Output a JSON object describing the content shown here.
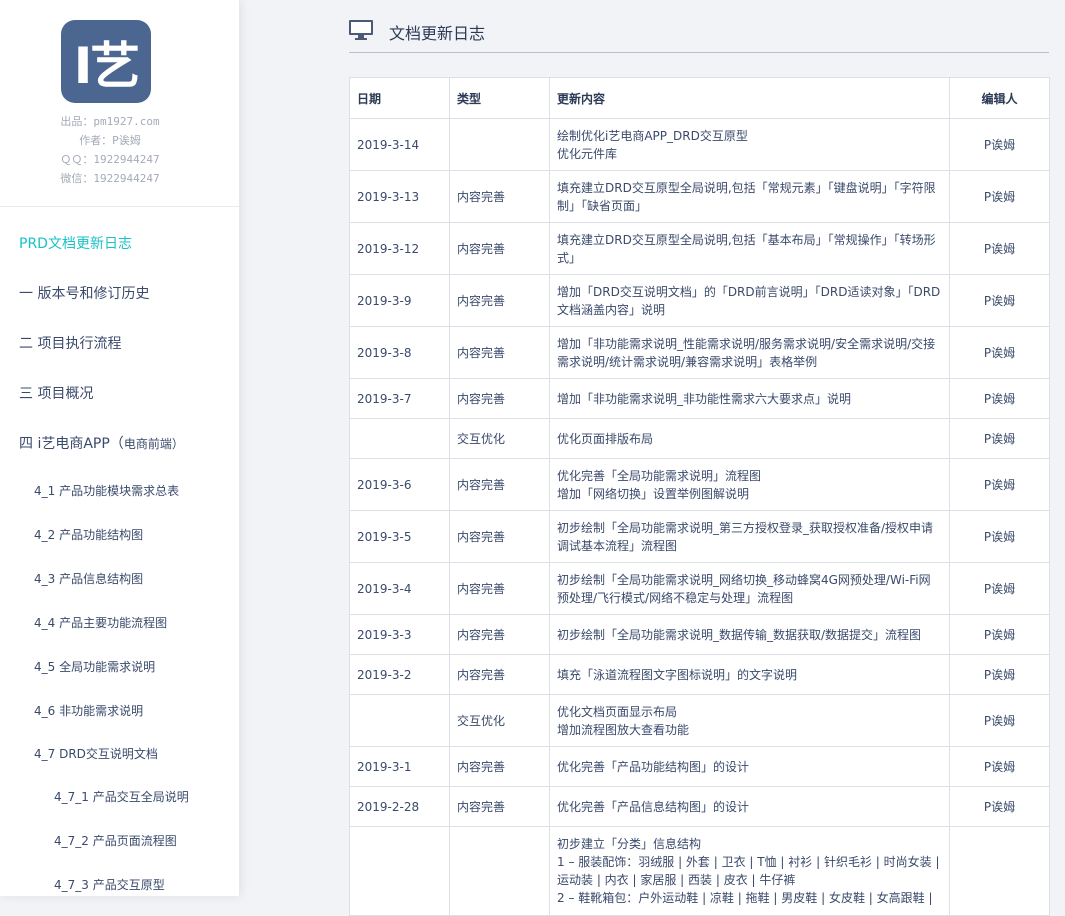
{
  "sidebar": {
    "logo_text": "I艺",
    "meta": [
      "出品：pm1927.com",
      "作者：P诶姆",
      "ＱＱ：1922944247",
      "微信：1922944247"
    ],
    "nav": [
      {
        "label": "PRD文档更新日志",
        "active": true
      },
      {
        "label": "一 版本号和修订历史"
      },
      {
        "label": "二 项目执行流程"
      },
      {
        "label": "三 项目概况"
      },
      {
        "label": "四 i艺电商APP（",
        "suffix": "电商前端）"
      },
      {
        "label": "4_1 产品功能模块需求总表"
      },
      {
        "label": "4_2 产品功能结构图"
      },
      {
        "label": "4_3 产品信息结构图"
      },
      {
        "label": "4_4 产品主要功能流程图"
      },
      {
        "label": "4_5 全局功能需求说明"
      },
      {
        "label": "4_6 非功能需求说明"
      },
      {
        "label": "4_7 DRD交互说明文档"
      },
      {
        "label": "4_7_1 产品交互全局说明"
      },
      {
        "label": "4_7_2 产品页面流程图"
      },
      {
        "label": "4_7_3 产品交互原型"
      }
    ]
  },
  "header": {
    "title": "文档更新日志",
    "icon": "monitor-icon"
  },
  "table": {
    "columns": [
      "日期",
      "类型",
      "更新内容",
      "编辑人"
    ],
    "rows": [
      {
        "date": "2019-3-14",
        "type": "",
        "content": [
          "绘制优化i艺电商APP_DRD交互原型",
          "优化元件库"
        ],
        "editor": "P诶姆"
      },
      {
        "date": "2019-3-13",
        "type": "内容完善",
        "content": [
          "填充建立DRD交互原型全局说明,包括「常规元素」「键盘说明」「字符限制」「缺省页面」"
        ],
        "editor": "P诶姆"
      },
      {
        "date": "2019-3-12",
        "type": "内容完善",
        "content": [
          "填充建立DRD交互原型全局说明,包括「基本布局」「常规操作」「转场形式」"
        ],
        "editor": "P诶姆"
      },
      {
        "date": "2019-3-9",
        "type": "内容完善",
        "content": [
          "增加「DRD交互说明文档」的「DRD前言说明」「DRD适读对象」「DRD文档涵盖内容」说明"
        ],
        "editor": "P诶姆"
      },
      {
        "date": "2019-3-8",
        "type": "内容完善",
        "content": [
          "增加「非功能需求说明_性能需求说明/服务需求说明/安全需求说明/交接需求说明/统计需求说明/兼容需求说明」表格举例"
        ],
        "editor": "P诶姆"
      },
      {
        "date": "2019-3-7",
        "type": "内容完善",
        "content": [
          "增加「非功能需求说明_非功能性需求六大要求点」说明"
        ],
        "editor": "P诶姆"
      },
      {
        "date": "",
        "type": "交互优化",
        "content": [
          "优化页面排版布局"
        ],
        "editor": "P诶姆"
      },
      {
        "date": "2019-3-6",
        "type": "内容完善",
        "content": [
          "优化完善「全局功能需求说明」流程图",
          "增加「网络切换」设置举例图解说明"
        ],
        "editor": "P诶姆"
      },
      {
        "date": "2019-3-5",
        "type": "内容完善",
        "content": [
          "初步绘制「全局功能需求说明_第三方授权登录_获取授权准备/授权申请调试基本流程」流程图"
        ],
        "editor": "P诶姆"
      },
      {
        "date": "2019-3-4",
        "type": "内容完善",
        "content": [
          "初步绘制「全局功能需求说明_网络切换_移动蜂窝4G网预处理/Wi-Fi网预处理/飞行模式/网络不稳定与处理」流程图"
        ],
        "editor": "P诶姆"
      },
      {
        "date": "2019-3-3",
        "type": "内容完善",
        "content": [
          "初步绘制「全局功能需求说明_数据传输_数据获取/数据提交」流程图"
        ],
        "editor": "P诶姆"
      },
      {
        "date": "2019-3-2",
        "type": "内容完善",
        "content": [
          "填充「泳道流程图文字图标说明」的文字说明"
        ],
        "editor": "P诶姆"
      },
      {
        "date": "",
        "type": "交互优化",
        "content": [
          "优化文档页面显示布局",
          "增加流程图放大查看功能"
        ],
        "editor": "P诶姆"
      },
      {
        "date": "2019-3-1",
        "type": "内容完善",
        "content": [
          "优化完善「产品功能结构图」的设计"
        ],
        "editor": "P诶姆"
      },
      {
        "date": "2019-2-28",
        "type": "内容完善",
        "content": [
          "优化完善「产品信息结构图」的设计"
        ],
        "editor": "P诶姆"
      },
      {
        "date": "",
        "type": "",
        "content": [
          "初步建立「分类」信息结构",
          "1 – 服装配饰：羽绒服 | 外套 | 卫衣 | T恤 | 衬衫 | 针织毛衫 | 时尚女装 | 运动装 | 内衣 | 家居服 | 西装 | 皮衣 | 牛仔裤",
          "2 – 鞋靴箱包：户外运动鞋 | 凉鞋 | 拖鞋 | 男皮鞋 | 女皮鞋 | 女高跟鞋 |"
        ],
        "editor": ""
      }
    ]
  },
  "colors": {
    "accent": "#19c2c7",
    "logo_bg": "#4b6690",
    "text": "#3a4a6b"
  }
}
